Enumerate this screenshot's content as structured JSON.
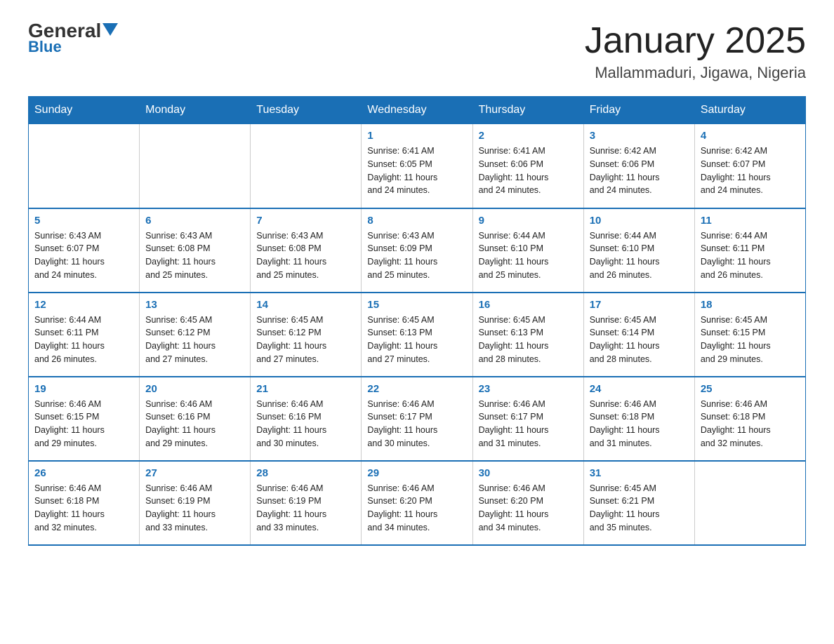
{
  "header": {
    "logo_general": "General",
    "logo_blue": "Blue",
    "month_title": "January 2025",
    "location": "Mallammaduri, Jigawa, Nigeria"
  },
  "days_of_week": [
    "Sunday",
    "Monday",
    "Tuesday",
    "Wednesday",
    "Thursday",
    "Friday",
    "Saturday"
  ],
  "weeks": [
    [
      {
        "day": "",
        "info": ""
      },
      {
        "day": "",
        "info": ""
      },
      {
        "day": "",
        "info": ""
      },
      {
        "day": "1",
        "info": "Sunrise: 6:41 AM\nSunset: 6:05 PM\nDaylight: 11 hours\nand 24 minutes."
      },
      {
        "day": "2",
        "info": "Sunrise: 6:41 AM\nSunset: 6:06 PM\nDaylight: 11 hours\nand 24 minutes."
      },
      {
        "day": "3",
        "info": "Sunrise: 6:42 AM\nSunset: 6:06 PM\nDaylight: 11 hours\nand 24 minutes."
      },
      {
        "day": "4",
        "info": "Sunrise: 6:42 AM\nSunset: 6:07 PM\nDaylight: 11 hours\nand 24 minutes."
      }
    ],
    [
      {
        "day": "5",
        "info": "Sunrise: 6:43 AM\nSunset: 6:07 PM\nDaylight: 11 hours\nand 24 minutes."
      },
      {
        "day": "6",
        "info": "Sunrise: 6:43 AM\nSunset: 6:08 PM\nDaylight: 11 hours\nand 25 minutes."
      },
      {
        "day": "7",
        "info": "Sunrise: 6:43 AM\nSunset: 6:08 PM\nDaylight: 11 hours\nand 25 minutes."
      },
      {
        "day": "8",
        "info": "Sunrise: 6:43 AM\nSunset: 6:09 PM\nDaylight: 11 hours\nand 25 minutes."
      },
      {
        "day": "9",
        "info": "Sunrise: 6:44 AM\nSunset: 6:10 PM\nDaylight: 11 hours\nand 25 minutes."
      },
      {
        "day": "10",
        "info": "Sunrise: 6:44 AM\nSunset: 6:10 PM\nDaylight: 11 hours\nand 26 minutes."
      },
      {
        "day": "11",
        "info": "Sunrise: 6:44 AM\nSunset: 6:11 PM\nDaylight: 11 hours\nand 26 minutes."
      }
    ],
    [
      {
        "day": "12",
        "info": "Sunrise: 6:44 AM\nSunset: 6:11 PM\nDaylight: 11 hours\nand 26 minutes."
      },
      {
        "day": "13",
        "info": "Sunrise: 6:45 AM\nSunset: 6:12 PM\nDaylight: 11 hours\nand 27 minutes."
      },
      {
        "day": "14",
        "info": "Sunrise: 6:45 AM\nSunset: 6:12 PM\nDaylight: 11 hours\nand 27 minutes."
      },
      {
        "day": "15",
        "info": "Sunrise: 6:45 AM\nSunset: 6:13 PM\nDaylight: 11 hours\nand 27 minutes."
      },
      {
        "day": "16",
        "info": "Sunrise: 6:45 AM\nSunset: 6:13 PM\nDaylight: 11 hours\nand 28 minutes."
      },
      {
        "day": "17",
        "info": "Sunrise: 6:45 AM\nSunset: 6:14 PM\nDaylight: 11 hours\nand 28 minutes."
      },
      {
        "day": "18",
        "info": "Sunrise: 6:45 AM\nSunset: 6:15 PM\nDaylight: 11 hours\nand 29 minutes."
      }
    ],
    [
      {
        "day": "19",
        "info": "Sunrise: 6:46 AM\nSunset: 6:15 PM\nDaylight: 11 hours\nand 29 minutes."
      },
      {
        "day": "20",
        "info": "Sunrise: 6:46 AM\nSunset: 6:16 PM\nDaylight: 11 hours\nand 29 minutes."
      },
      {
        "day": "21",
        "info": "Sunrise: 6:46 AM\nSunset: 6:16 PM\nDaylight: 11 hours\nand 30 minutes."
      },
      {
        "day": "22",
        "info": "Sunrise: 6:46 AM\nSunset: 6:17 PM\nDaylight: 11 hours\nand 30 minutes."
      },
      {
        "day": "23",
        "info": "Sunrise: 6:46 AM\nSunset: 6:17 PM\nDaylight: 11 hours\nand 31 minutes."
      },
      {
        "day": "24",
        "info": "Sunrise: 6:46 AM\nSunset: 6:18 PM\nDaylight: 11 hours\nand 31 minutes."
      },
      {
        "day": "25",
        "info": "Sunrise: 6:46 AM\nSunset: 6:18 PM\nDaylight: 11 hours\nand 32 minutes."
      }
    ],
    [
      {
        "day": "26",
        "info": "Sunrise: 6:46 AM\nSunset: 6:18 PM\nDaylight: 11 hours\nand 32 minutes."
      },
      {
        "day": "27",
        "info": "Sunrise: 6:46 AM\nSunset: 6:19 PM\nDaylight: 11 hours\nand 33 minutes."
      },
      {
        "day": "28",
        "info": "Sunrise: 6:46 AM\nSunset: 6:19 PM\nDaylight: 11 hours\nand 33 minutes."
      },
      {
        "day": "29",
        "info": "Sunrise: 6:46 AM\nSunset: 6:20 PM\nDaylight: 11 hours\nand 34 minutes."
      },
      {
        "day": "30",
        "info": "Sunrise: 6:46 AM\nSunset: 6:20 PM\nDaylight: 11 hours\nand 34 minutes."
      },
      {
        "day": "31",
        "info": "Sunrise: 6:45 AM\nSunset: 6:21 PM\nDaylight: 11 hours\nand 35 minutes."
      },
      {
        "day": "",
        "info": ""
      }
    ]
  ]
}
